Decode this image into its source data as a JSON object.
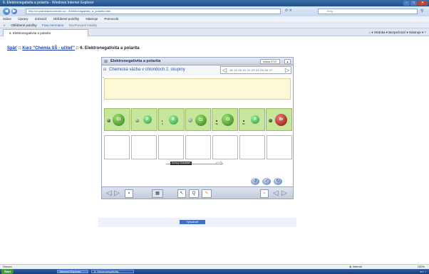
{
  "window": {
    "title": "6. Elektronegativita a polarita - Windows Internet Explorer",
    "controls": [
      "minimize",
      "maximize",
      "close"
    ]
  },
  "addressbar": {
    "url": "http://ov.planetavedomosti.cz/.../Elektronegativita_a_polarita.html",
    "search_placeholder": "Bing"
  },
  "menu": [
    "Súbor",
    "Úpravy",
    "Zobraziť",
    "Obľúbené položky",
    "Nástroje",
    "Pomocník"
  ],
  "favorites": {
    "label": "Obľúbené položky",
    "items": [
      "Frau Herrmann",
      "Navrhované lokality"
    ]
  },
  "tab": {
    "label": "6. Elektronegativita a polarita"
  },
  "commandbar": {
    "items": [
      "Stránka",
      "Bezpečnosť",
      "Nástroje"
    ]
  },
  "breadcrumb": {
    "back": "Späť",
    "separator": "::",
    "course": "Kurz \"Chémia SŠ - učiteľ\"",
    "current": "6. Elektronegativita a polarita"
  },
  "panel": {
    "title": "Elektronegativita a polarita",
    "page_indicator": "strana 27/27",
    "subtitle": "Chemická väzba v chloridoch 2. skupiny",
    "pager_numbers": "18 19 20 21 22 23 24 25 26 27",
    "axis_label": "iónový charakter",
    "molecules": [
      {
        "label": "Cl",
        "color": "#3a9d2b",
        "partner": "#444444",
        "partner_label": ""
      },
      {
        "label": "F",
        "color": "#2fb24a",
        "partner": "#777777",
        "partner_label": ""
      },
      {
        "label": "F",
        "color": "#2fb24a",
        "partner": "#999999",
        "partner_label": "Li"
      },
      {
        "label": "Cl",
        "color": "#3a9d2b",
        "partner": "#888888",
        "partner_label": ""
      },
      {
        "label": "Cl",
        "color": "#3a9d2b",
        "partner": "#666666",
        "partner_label": "Be"
      },
      {
        "label": "F",
        "color": "#2fb24a",
        "partner": "#555555",
        "partner_label": "Be"
      },
      {
        "label": "Br",
        "color": "#b01e1e",
        "partner": "#333333",
        "partner_label": ""
      }
    ],
    "toolbar": {
      "zoom_label": "Q"
    }
  },
  "action_button": "Vyhodnotiť",
  "statusbar": {
    "left": "Hotovo",
    "zone": "Internet",
    "zoom": "100%"
  },
  "taskbar": {
    "start": "Štart",
    "tasks": [
      "Internet Explorer",
      "6. Elektronegativita..."
    ]
  },
  "colors": {
    "accent": "#2c55a8",
    "molecule_bg": "#c6e79a",
    "yellow_area": "#fdf8d6"
  }
}
